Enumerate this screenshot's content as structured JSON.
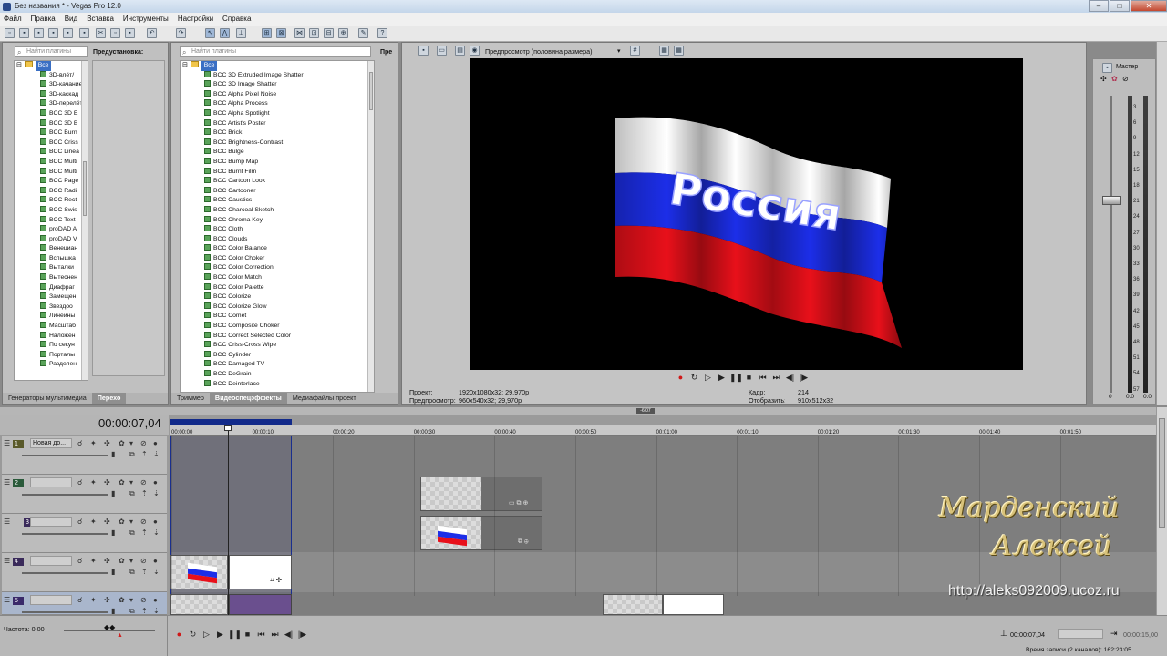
{
  "window": {
    "title": "Без названия * - Vegas Pro 12.0"
  },
  "menu": [
    "Файл",
    "Правка",
    "Вид",
    "Вставка",
    "Инструменты",
    "Настройки",
    "Справка"
  ],
  "transitions_panel": {
    "search_placeholder": "Найти плагины",
    "root": "Все",
    "items": [
      "3D-влёт/",
      "3D-качание",
      "3D-каскад",
      "3D-перелёт",
      "BCC 3D E",
      "BCC 3D B",
      "BCC Burn",
      "BCC Criss",
      "BCC Linea",
      "BCC Multi",
      "BCC Multi",
      "BCC Page",
      "BCC Radi",
      "BCC Rect",
      "BCC Swis",
      "BCC Text",
      "proDAD A",
      "proDAD V",
      "Венециан",
      "Вспышка",
      "Выталки",
      "Вытеснен",
      "Диафраг",
      "Замещен",
      "Звездоо",
      "Линейны",
      "Масштаб",
      "Наложен",
      "По секун",
      "Порталы",
      "Разделен"
    ],
    "presets_label": "Предустановка:"
  },
  "fx_panel": {
    "search_placeholder": "Найти плагины",
    "root": "Все",
    "presets_label": "Пре",
    "items": [
      "BCC 3D Extruded Image Shatter",
      "BCC 3D Image Shatter",
      "BCC Alpha Pixel Noise",
      "BCC Alpha Process",
      "BCC Alpha Spotlight",
      "BCC Artist's Poster",
      "BCC Brick",
      "BCC Brightness-Contrast",
      "BCC Bulge",
      "BCC Bump Map",
      "BCC Burnt Film",
      "BCC Cartoon Look",
      "BCC Cartooner",
      "BCC Caustics",
      "BCC Charcoal Sketch",
      "BCC Chroma Key",
      "BCC Cloth",
      "BCC Clouds",
      "BCC Color Balance",
      "BCC Color Choker",
      "BCC Color Correction",
      "BCC Color Match",
      "BCC Color Palette",
      "BCC Colorize",
      "BCC Colorize Glow",
      "BCC Comet",
      "BCC Composite Choker",
      "BCC Correct Selected Color",
      "BCC Criss-Cross Wipe",
      "BCC Cylinder",
      "BCC Damaged TV",
      "BCC DeGrain",
      "BCC Deinterlace"
    ]
  },
  "left_tabs": [
    "Генераторы мультимедиа",
    "Перехо"
  ],
  "mid_tabs": [
    "Триммер",
    "Видеоспецэффекты",
    "Медиафайлы проект"
  ],
  "preview": {
    "mode_label": "Предпросмотр (половина размера)",
    "flag_text": "Россия",
    "project_label": "Проект:",
    "project_value": "1920x1080x32; 29,970p",
    "preview_label": "Предпросмотр:",
    "preview_value": "960x540x32; 29,970p",
    "frame_label": "Кадр:",
    "frame_value": "214",
    "display_label": "Отобразить:",
    "display_value": "910x512x32"
  },
  "mixer": {
    "master_label": "Мастер",
    "scale": [
      "3",
      "6",
      "9",
      "12",
      "15",
      "18",
      "21",
      "24",
      "27",
      "30",
      "33",
      "36",
      "39",
      "42",
      "45",
      "48",
      "51",
      "54",
      "57"
    ],
    "left_value": "0",
    "mid_value": "0.0",
    "right_value": "0.0"
  },
  "timeline": {
    "timecode": "00:00:07,04",
    "ruler": [
      "00:00:00",
      "00:00:10",
      "00:00:20",
      "00:00:30",
      "00:00:40",
      "00:00:50",
      "00:01:00",
      "00:01:10",
      "00:01:20",
      "00:01:30",
      "00:01:40",
      "00:01:50"
    ],
    "tracks": [
      {
        "num": "1",
        "name": "Новая до..."
      },
      {
        "num": "2",
        "name": ""
      },
      {
        "num": "3",
        "name": ""
      },
      {
        "num": "4",
        "name": ""
      },
      {
        "num": "5",
        "name": ""
      }
    ],
    "marker_label": "-6:07",
    "rate_label": "Частота: 0,00",
    "end_time": "00:00:15,00",
    "cursor_time": "00:00:07,04",
    "record_time": "Время записи (2 каналов): 162:23:05"
  },
  "watermark": {
    "line1": "Марденский",
    "line2": "Алексей",
    "url": "http://aleks092009.ucoz.ru"
  },
  "colors": {
    "flag_white": "#ffffff",
    "flag_blue": "#1c2ee8",
    "flag_red": "#e8101a",
    "accent": "#3a6fc4"
  }
}
